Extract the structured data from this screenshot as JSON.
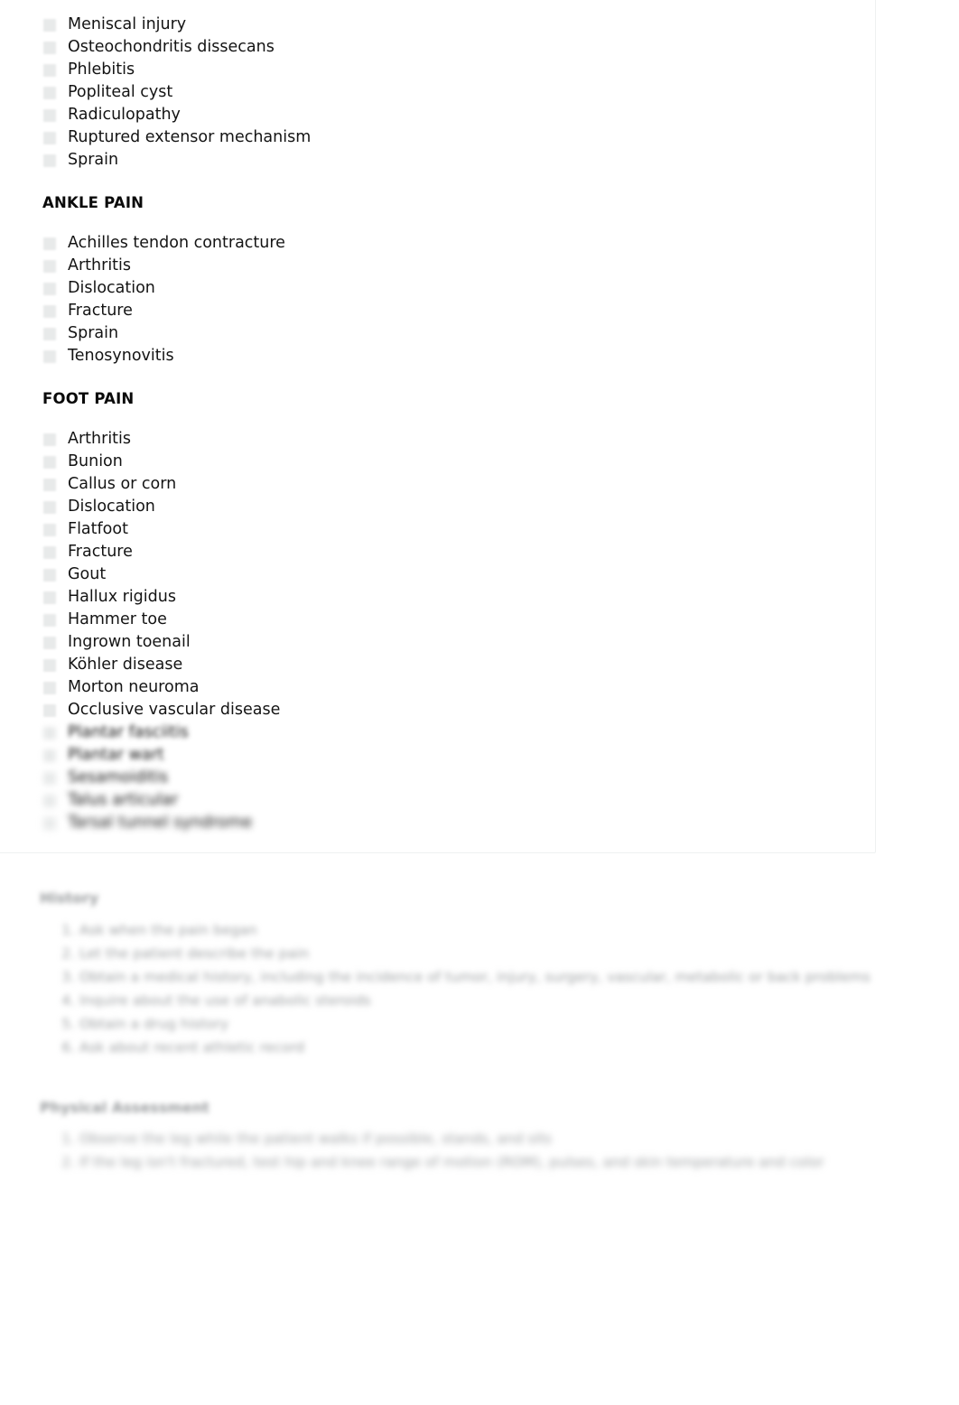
{
  "document": {
    "card": {
      "sections": [
        {
          "heading": null,
          "heading_visible": false,
          "items": [
            {
              "label": "Meniscal injury",
              "blur": 0
            },
            {
              "label": "Osteochondritis dissecans",
              "blur": 0
            },
            {
              "label": "Phlebitis",
              "blur": 0
            },
            {
              "label": "Popliteal cyst",
              "blur": 0
            },
            {
              "label": "Radiculopathy",
              "blur": 0
            },
            {
              "label": "Ruptured extensor mechanism",
              "blur": 0
            },
            {
              "label": "Sprain",
              "blur": 0
            }
          ]
        },
        {
          "heading": "ANKLE PAIN",
          "heading_visible": true,
          "items": [
            {
              "label": "Achilles tendon contracture",
              "blur": 0
            },
            {
              "label": "Arthritis",
              "blur": 0
            },
            {
              "label": "Dislocation",
              "blur": 0
            },
            {
              "label": "Fracture",
              "blur": 0
            },
            {
              "label": "Sprain",
              "blur": 0
            },
            {
              "label": "Tenosynovitis",
              "blur": 0
            }
          ]
        },
        {
          "heading": "FOOT PAIN",
          "heading_visible": true,
          "items": [
            {
              "label": "Arthritis",
              "blur": 0
            },
            {
              "label": "Bunion",
              "blur": 0
            },
            {
              "label": "Callus or corn",
              "blur": 0
            },
            {
              "label": "Dislocation",
              "blur": 0
            },
            {
              "label": "Flatfoot",
              "blur": 0
            },
            {
              "label": "Fracture",
              "blur": 0
            },
            {
              "label": "Gout",
              "blur": 0
            },
            {
              "label": "Hallux rigidus",
              "blur": 0
            },
            {
              "label": "Hammer toe",
              "blur": 0
            },
            {
              "label": "Ingrown toenail",
              "blur": 0
            },
            {
              "label": "Köhler disease",
              "blur": 0
            },
            {
              "label": "Morton neuroma",
              "blur": 0
            },
            {
              "label": "Occlusive vascular disease",
              "blur": 0
            },
            {
              "label": "Plantar fasciitis",
              "blur": 1
            },
            {
              "label": "Plantar wart",
              "blur": 2
            },
            {
              "label": "Sesamoiditis",
              "blur": 3
            },
            {
              "label": "Talus articular",
              "blur": 4
            },
            {
              "label": "Tarsal tunnel syndrome",
              "blur": 5
            }
          ]
        }
      ]
    },
    "lower": {
      "history": {
        "heading": "History",
        "steps": [
          "Ask when the pain began",
          "Let the patient describe the pain",
          "Obtain a medical history, including the incidence of tumor, injury, surgery, vascular, metabolic or back problems",
          "Inquire about the use of anabolic steroids",
          "Obtain a drug history",
          "Ask about recent athletic record"
        ]
      },
      "physical_assessment": {
        "heading": "Physical Assessment",
        "steps": [
          "Observe the leg while the patient walks if possible, stands, and sits",
          "If the leg isn't fractured, test hip and knee range of motion (ROM), pulses, and skin temperature and color"
        ]
      }
    }
  }
}
